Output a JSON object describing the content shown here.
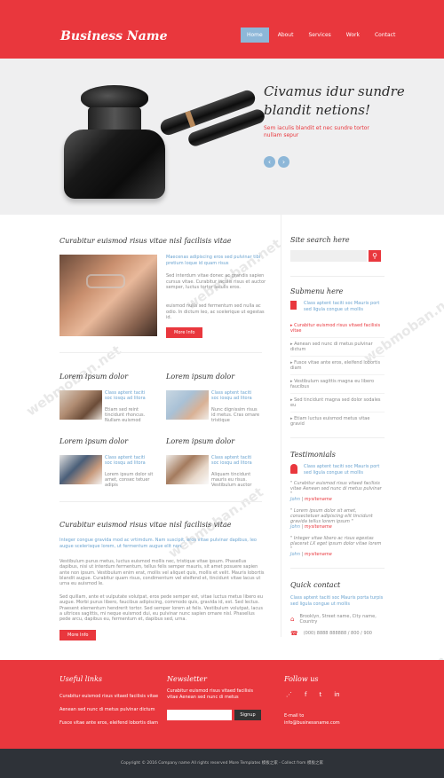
{
  "header": {
    "logo": "Business Name",
    "nav": [
      "Home",
      "About",
      "Services",
      "Work",
      "Contact"
    ]
  },
  "hero": {
    "title": "Civamus idur sundre blandit netions!",
    "text": "Sem iaculis blandit et nec sundre tortor nullam sepur"
  },
  "feature": {
    "title": "Curabitur euismod risus vitae nisl facilisis vitae",
    "link": "Maecenas adipiscing eros sed pulvinar tibi pretium loque id quam risus",
    "text1": "Sed interdum vitae donec ac grandis sapien cursus vitae. Curabitur iaculis risus et auctor semper, luctus tortor iaculis eros.",
    "text2": "euismod nulla sed fermentum sed nulla ac odio. In dictum leo, ac scelerique ut egestas id.",
    "btn": "More Info"
  },
  "staff": [
    {
      "title": "Lorem ipsum dolor",
      "link": "Class aptent taciti soc iosqu ad litora",
      "text": "Etiam sed reint tincidunt rhoncus. Nullam euismod"
    },
    {
      "title": "Lorem ipsum dolor",
      "link": "Class aptent taciti soc iosqu ad litora",
      "text": "Nunc dignissim risus id metus. Cras ornare tristique"
    },
    {
      "title": "Lorem ipsum dolor",
      "link": "Class aptent taciti soc iosqu ad litora",
      "text": "Lorem ipsum dolor sit amet, consec tetuer adipis"
    },
    {
      "title": "Lorem ipsum dolor",
      "link": "Class aptent taciti soc iosqu ad litora",
      "text": "Aliquam tincidunt mauris eu risus. Vestibulum auctor"
    }
  ],
  "article": {
    "title": "Curabitur euismod risus vitae nisl facilisis vitae",
    "lead": "Integer congue gravida mod ac vrtimdum. Nam suscipit, eros vitae pulvinar dapibus, leo augue scelerisque lorem, ut fermentum augue elit non.",
    "p1": "Vestibulum purus metus, luctus euismod mollis nec, tristique vitae ipsum. Phasellus dapibus, nisi ut interdum fermentum, tellus felis semper mauris, sit amet posuere sapien ante non ipsum. Vestibulum enim erat, mollis vel aliquet quis, mollis et velit. Mauris lobortis blandit augue. Curabitur quam risus, condimentum vel eleifend et, tincidunt vitae lacus ut urna eu auismod le.",
    "p2": "Sed quillam, ante et vulputate volutpat, eros pede semper est, vitae luctus metus libero eu augue. Morbi purus libero, faucibus adipiscing, commodo quis, gravida id, est. Sed lectus. Praesent elementum hendrerit tortor. Sed semper lorem at felis. Vestibulum volutpat, lacus a ultrices sagittis, mi neque euismod dui, eu pulvinar nunc sapien ornare nisl. Phasellus pede arcu, dapibus eu, fermentum et, dapibus sed, urna.",
    "btn": "More Info"
  },
  "sidebar": {
    "search_title": "Site search here",
    "submenu_title": "Submenu here",
    "submenu_intro": "Class aptent taciti soc Mauris port sed ligula congue ut mollis",
    "submenu": [
      "Curabitur euismod risus vitaed facilisis vitae",
      "Aenean sed nunc di metus pulvinar dictum",
      "Fusce vitae ante eros, eleifend lobortis diam",
      "Vestibulum sagittis magna eu libero faucibus",
      "Sed tincidunt magna sed dolor sodales eu",
      "Etiam luctus euismod metus vitae gravid"
    ],
    "testimonials_title": "Testimonials",
    "testimonials_intro": "Class aptent taciti soc Mauris port sed ligula congue ut mollis",
    "quotes": [
      {
        "text": "\" Curabitur euismod risus vitaed facilisis vitae Aenean sed nunc di metus pulvinar \"",
        "author": "John",
        "site": "mysitename"
      },
      {
        "text": "\" Lorem ipsum dolor sit amet, consectetuer adipiscing elit tincidunt gravida tellus lorem ipsum \"",
        "author": "John",
        "site": "mysitename"
      },
      {
        "text": "\" Integer vitae libero ac risus egestas placerat LX eget ipsum dolor vitae lorem \"",
        "author": "John",
        "site": "mysitename"
      }
    ],
    "contact_title": "Quick contact",
    "contact_intro": "Class aptent taciti soc Mauris porta turpis sed ligula congue ut mollis",
    "address": "Brooklyn, Street name, City name, Country",
    "phone": "(000) 8888 888888 / 800 / 900"
  },
  "footer": {
    "links_title": "Useful links",
    "links": [
      "Curabitur euismod risus vitaed facilisis vitae",
      "Aenean sed nunc di metus pulvinar dictum",
      "Fusce vitae ante eros, eleifend lobortis diam"
    ],
    "newsletter_title": "Newsletter",
    "newsletter_text": "Curabitur euismod risus vitaed facilisis vitae Aenean sed nunc di metus",
    "signup": "Signup",
    "follow_title": "Follow us",
    "email_label": "E-mail to",
    "email": "info@businessname.com"
  },
  "copyright": "Copyright © 2016 Company name All rights reserved More Templates 模板之家 - Collect from 模板之家",
  "watermark": "webmoban.net"
}
